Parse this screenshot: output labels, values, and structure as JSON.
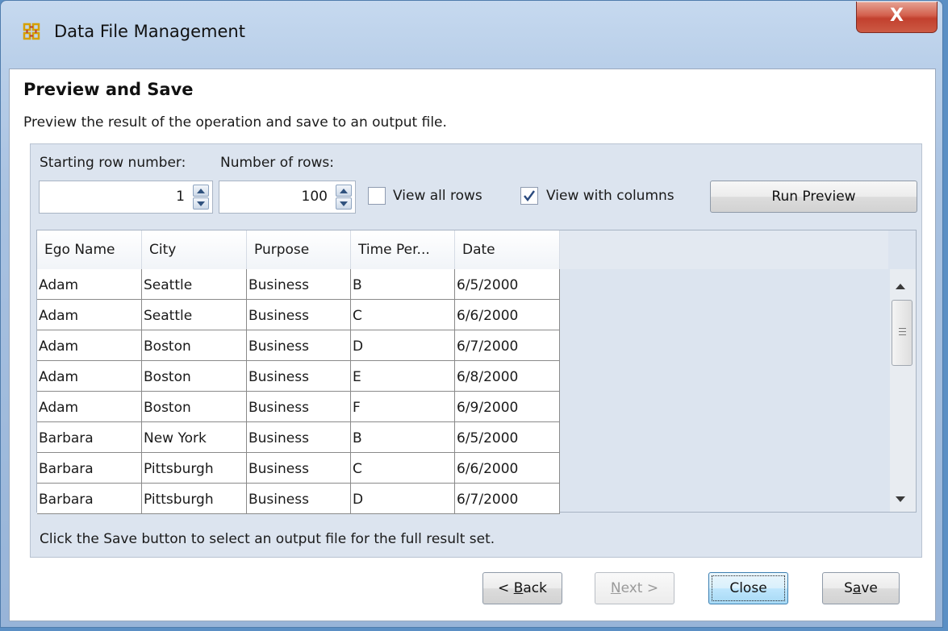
{
  "window": {
    "title": "Data File Management",
    "close_glyph": "X",
    "icon": "ora-network-icon"
  },
  "page": {
    "heading": "Preview and Save",
    "description": "Preview the result of the operation and save to an output file."
  },
  "controls": {
    "starting_row_label": "Starting row number:",
    "num_rows_label": "Number of rows:",
    "starting_row_value": "1",
    "num_rows_value": "100",
    "view_all_rows_label": "View all rows",
    "view_all_rows_checked": false,
    "view_with_columns_label": "View with columns",
    "view_with_columns_checked": true,
    "run_preview_label": "Run Preview"
  },
  "table": {
    "columns": [
      "Ego Name",
      "City",
      "Purpose",
      "Time Per...",
      "Date"
    ],
    "rows": [
      [
        "Adam",
        "Seattle",
        "Business",
        "B",
        "6/5/2000"
      ],
      [
        "Adam",
        "Seattle",
        "Business",
        "C",
        "6/6/2000"
      ],
      [
        "Adam",
        "Boston",
        "Business",
        "D",
        "6/7/2000"
      ],
      [
        "Adam",
        "Boston",
        "Business",
        "E",
        "6/8/2000"
      ],
      [
        "Adam",
        "Boston",
        "Business",
        "F",
        "6/9/2000"
      ],
      [
        "Barbara",
        "New York",
        "Business",
        "B",
        "6/5/2000"
      ],
      [
        "Barbara",
        "Pittsburgh",
        "Business",
        "C",
        "6/6/2000"
      ],
      [
        "Barbara",
        "Pittsburgh",
        "Business",
        "D",
        "6/7/2000"
      ]
    ]
  },
  "footnote": "Click the Save button to select an output file for the full result set.",
  "buttons": {
    "back": {
      "prefix": "< ",
      "mnemonic": "B",
      "rest": "ack"
    },
    "next": {
      "mnemonic": "N",
      "rest": "ext >",
      "enabled": false
    },
    "close": "Close",
    "save": {
      "prefix": "S",
      "mnemonic": "a",
      "rest": "ve"
    }
  },
  "colors": {
    "frame": "#a9c2e1",
    "panel": "#dce4ef",
    "close_button": "#c9503c"
  }
}
